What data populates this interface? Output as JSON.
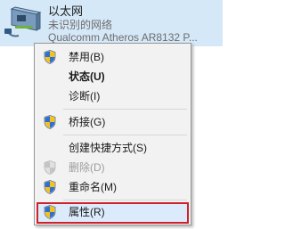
{
  "adapter": {
    "name": "以太网",
    "status": "未识别的网络",
    "device": "Qualcomm Atheros AR8132 P..."
  },
  "menu": {
    "items": [
      {
        "label": "禁用(B)",
        "shield": true
      },
      {
        "label": "状态(U)",
        "bold": true
      },
      {
        "label": "诊断(I)"
      },
      {
        "label": "桥接(G)",
        "shield": true
      },
      {
        "label": "创建快捷方式(S)"
      },
      {
        "label": "删除(D)",
        "shield": true,
        "disabled": true
      },
      {
        "label": "重命名(M)",
        "shield": true
      },
      {
        "label": "属性(R)",
        "shield": true,
        "highlighted": true
      }
    ]
  },
  "colors": {
    "selection": "#d5e8f8",
    "highlight_border": "#d0202a",
    "menu_bg": "#f2f2f2"
  }
}
